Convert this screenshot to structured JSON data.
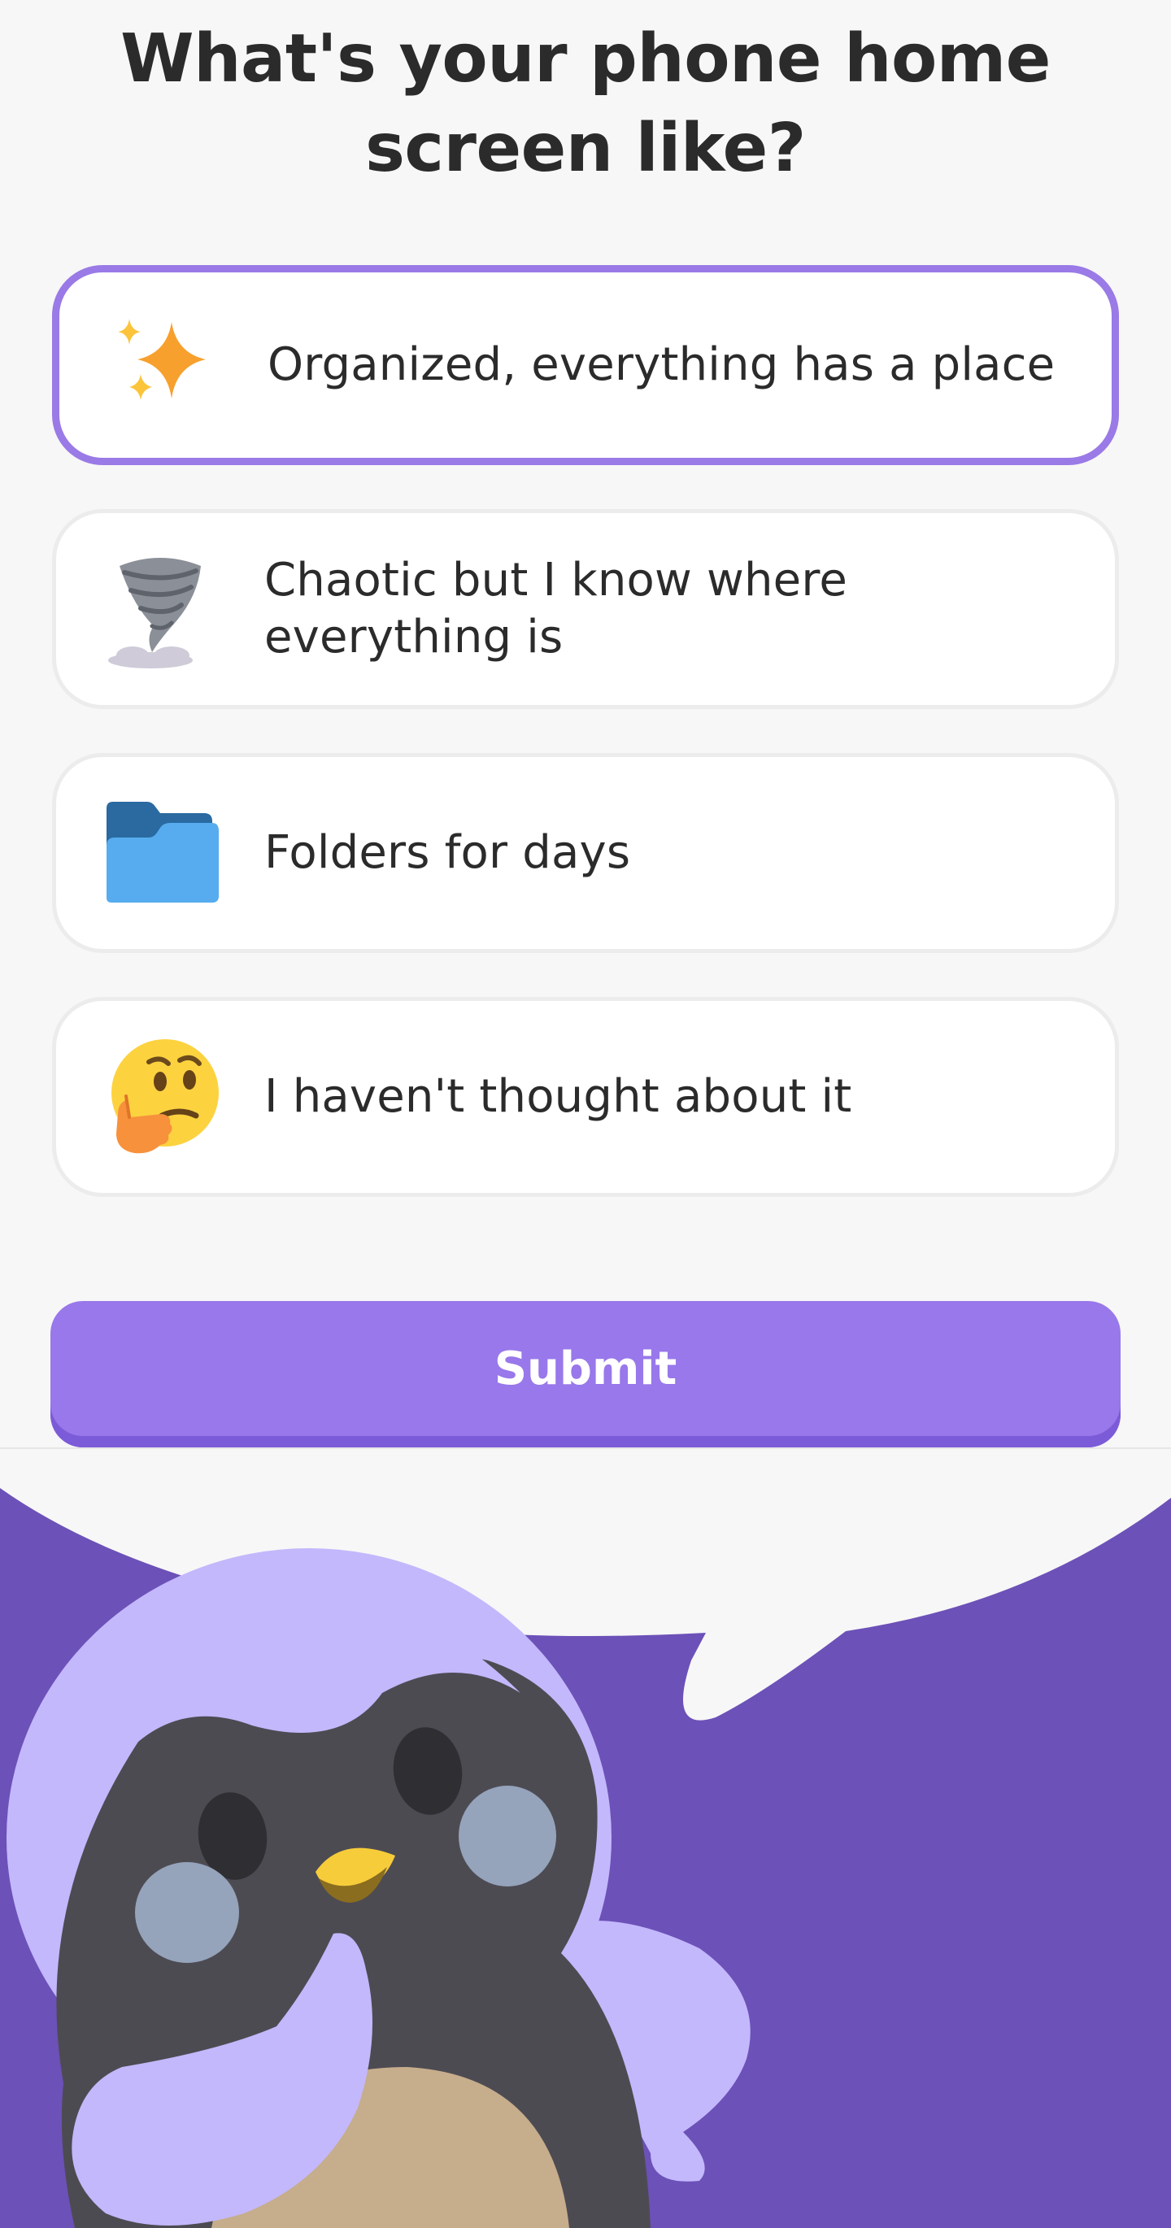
{
  "question": {
    "title": "What's your phone home screen like?"
  },
  "options": [
    {
      "label": "Organized, everything has a place",
      "icon": "sparkles-icon",
      "selected": true
    },
    {
      "label": "Chaotic but I know where everything is",
      "icon": "tornado-icon",
      "selected": false
    },
    {
      "label": "Folders for days",
      "icon": "folder-icon",
      "selected": false
    },
    {
      "label": "I haven't thought about it",
      "icon": "thinking-face-icon",
      "selected": false
    }
  ],
  "submit": {
    "label": "Submit"
  },
  "colors": {
    "accent": "#9878ea",
    "accent_dark": "#7c5bd8",
    "selected_border": "#9a7ae6",
    "scene_background": "#6c51b8",
    "mascot_body": "#4d4b52",
    "mascot_hood": "#c3b8fc",
    "mascot_belly": "#c6ad8c",
    "mascot_beak": "#f6cc3a"
  }
}
